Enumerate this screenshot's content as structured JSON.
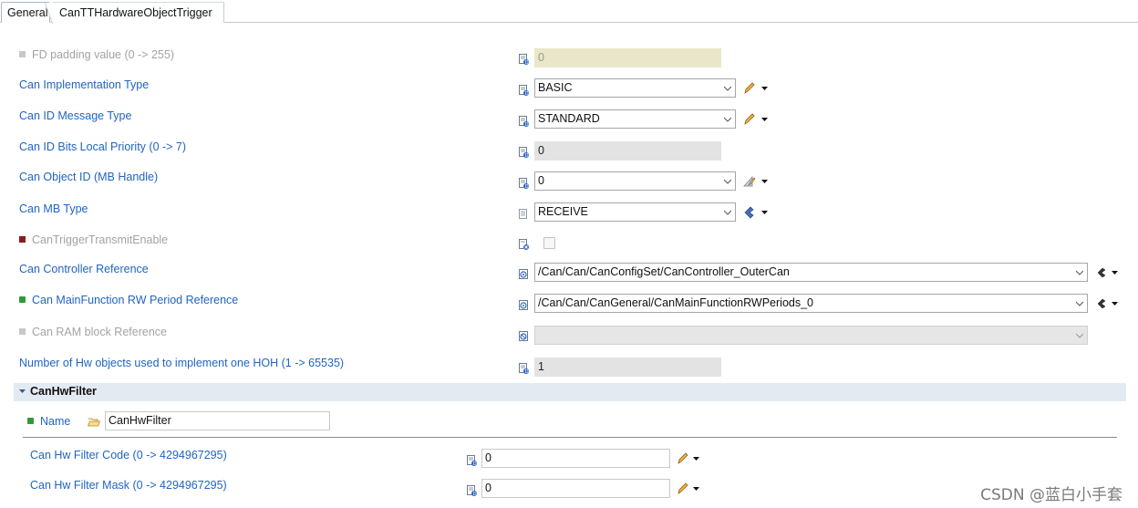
{
  "tabs": [
    {
      "label": "General",
      "active": true
    },
    {
      "label": "CanTTHardwareObjectTrigger",
      "active": false
    }
  ],
  "rows": {
    "fd_padding": {
      "label": "FD padding value (0 -> 255)",
      "value": "0"
    },
    "impl_type": {
      "label": "Can Implementation Type",
      "value": "BASIC"
    },
    "id_msg_type": {
      "label": "Can ID Message Type",
      "value": "STANDARD"
    },
    "id_bits_prio": {
      "label": "Can ID Bits Local Priority (0 -> 7)",
      "value": "0"
    },
    "object_id": {
      "label": "Can Object ID (MB Handle)",
      "value": "0"
    },
    "mb_type": {
      "label": "Can MB Type",
      "value": "RECEIVE"
    },
    "trigger_tx": {
      "label": "CanTriggerTransmitEnable",
      "checked": false
    },
    "controller_ref": {
      "label": "Can Controller Reference",
      "value": "/Can/Can/CanConfigSet/CanController_OuterCan"
    },
    "mainfunc_ref": {
      "label": "Can MainFunction RW Period Reference",
      "value": "/Can/Can/CanGeneral/CanMainFunctionRWPeriods_0"
    },
    "ram_block_ref": {
      "label": "Can RAM block Reference",
      "value": ""
    },
    "hw_objects": {
      "label": "Number of Hw objects used to implement one HOH (1 -> 65535)",
      "value": "1"
    }
  },
  "hw_filter": {
    "section_title": "CanHwFilter",
    "name_label": "Name",
    "name_value": "CanHwFilter",
    "code_label": "Can Hw Filter Code (0 -> 4294967295)",
    "code_value": "0",
    "mask_label": "Can Hw Filter Mask (0 -> 4294967295)",
    "mask_value": "0"
  },
  "watermark": "CSDN @蓝白小手套",
  "colors": {
    "link": "#2065c2",
    "disabled": "#a3a3a3",
    "section_bg": "#e4eaf2"
  }
}
